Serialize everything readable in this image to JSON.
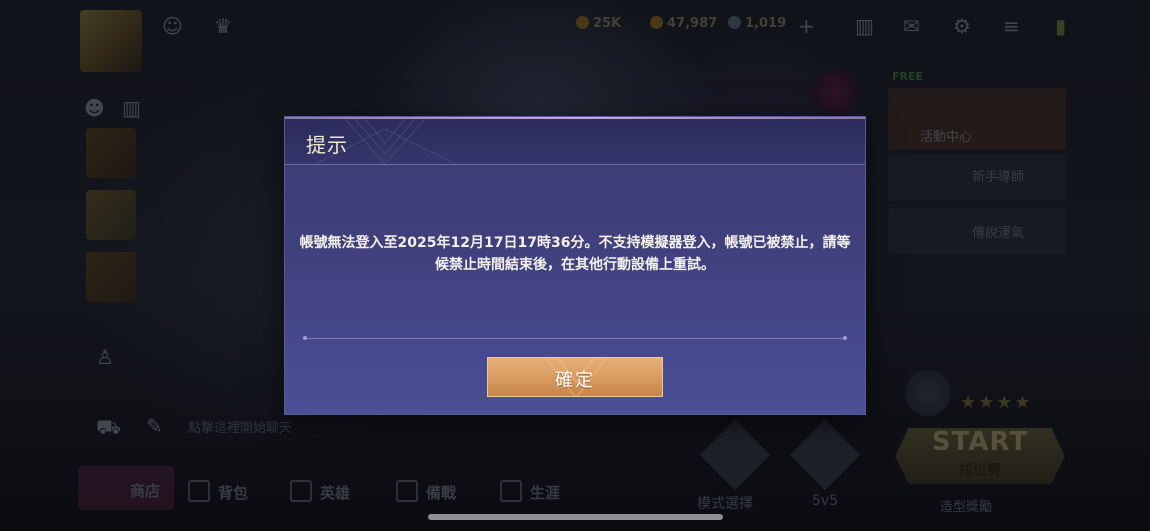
{
  "topbar": {
    "resource_1": "25K",
    "resource_2": "47,987",
    "resource_3": "1,019"
  },
  "left": {
    "chat_hint": "點擊這裡開始聊天"
  },
  "right": {
    "free_badge": "FREE",
    "activity_center": "活動中心",
    "item_2": "新手導師",
    "item_3": "傳說運氣"
  },
  "bottom": {
    "tabs": [
      "商店",
      "背包",
      "英雄",
      "備戰",
      "生涯"
    ],
    "mode_select": "模式選擇",
    "mode_5v5": "5v5",
    "start": "START",
    "ranked": "排位賽",
    "create_room": "造型獎勵"
  },
  "modal": {
    "title": "提示",
    "message": "帳號無法登入至2025年12月17日17時36分。不支持模擬器登入，帳號已被禁止，請等候禁止時間結束後，在其他行動設備上重試。",
    "confirm_label": "確定"
  },
  "colors": {
    "modal_bg": "#3f3f7b",
    "button_gold": "#d89a5e",
    "title_text": "#f2e8d4"
  }
}
